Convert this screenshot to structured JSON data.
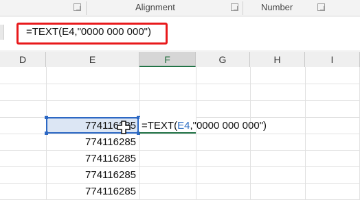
{
  "ribbon": {
    "groups": [
      "Alignment",
      "Number"
    ]
  },
  "formula_bar": {
    "content": "=TEXT(E4,\"0000 000 000\")"
  },
  "columns": [
    "D",
    "E",
    "F",
    "G",
    "H",
    "I"
  ],
  "active_column": "F",
  "cells": {
    "E_values": [
      "774116285",
      "774116285",
      "774116285",
      "774116285",
      "774116285"
    ]
  },
  "edit_cell": {
    "prefix": "=TEXT(",
    "ref": "E4",
    "suffix": ",\"0000 000 000\")"
  },
  "colors": {
    "highlight_box": "#e8191b",
    "selection_border": "#2c68c4",
    "excel_green": "#217346",
    "reference_blue": "#2f6fc4"
  },
  "icons": {
    "cursor": "cell-select-plus-cursor",
    "launcher": "dialog-launcher-icon"
  }
}
